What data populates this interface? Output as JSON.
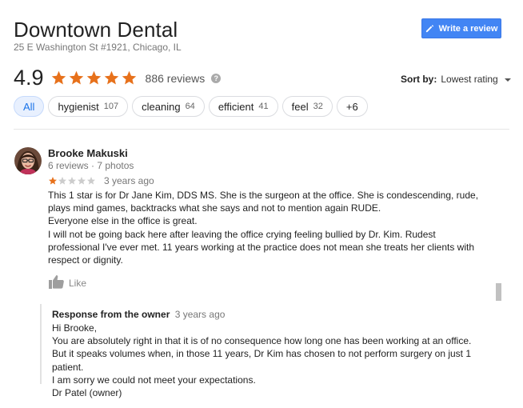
{
  "business": {
    "name": "Downtown Dental",
    "address": "25 E Washington St #1921, Chicago, IL"
  },
  "write_review_label": "Write a review",
  "rating": {
    "value": "4.9",
    "stars": 5,
    "reviews_label": "886 reviews"
  },
  "sort": {
    "label": "Sort by:",
    "value": "Lowest rating"
  },
  "chips": [
    {
      "label": "All",
      "count": ""
    },
    {
      "label": "hygienist",
      "count": "107"
    },
    {
      "label": "cleaning",
      "count": "64"
    },
    {
      "label": "efficient",
      "count": "41"
    },
    {
      "label": "feel",
      "count": "32"
    },
    {
      "label": "+6",
      "count": ""
    }
  ],
  "review": {
    "author": "Brooke Makuski",
    "meta": "6 reviews · 7 photos",
    "rating": 1,
    "age": "3 years ago",
    "paragraphs": [
      "This 1 star is for Dr Jane Kim, DDS MS. She is the surgeon at the office. She is condescending, rude, plays mind games, backtracks what she says and not to mention again RUDE.",
      "Everyone else in the office is great.",
      "I will not be going back here after leaving the office crying feeling bullied by Dr. Kim. Rudest professional I've ever met. 11 years working at the practice does not mean she treats her clients with respect or dignity."
    ],
    "like_label": "Like"
  },
  "owner_response": {
    "label": "Response from the owner",
    "age": "3 years ago",
    "lines": [
      "Hi Brooke,",
      "You are absolutely right in that it is of no consequence how long one has been working at an office. But it speaks volumes when, in those 11 years, Dr Kim has chosen to not perform surgery on just 1 patient.",
      "I am sorry we could not meet your expectations.",
      "Dr Patel (owner)"
    ]
  },
  "colors": {
    "star": "#e7711b",
    "star_empty": "#cccccc",
    "accent": "#4285f4"
  }
}
